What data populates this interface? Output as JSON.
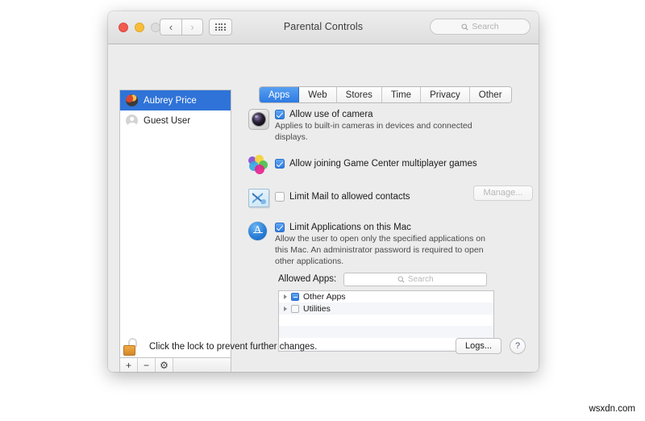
{
  "window": {
    "title": "Parental Controls",
    "traffic_lights": [
      "close",
      "minimize",
      "zoom-disabled"
    ],
    "nav_back": "‹",
    "nav_forward": "›",
    "grid_button": "show-all-icon",
    "toolbar_search_placeholder": "Search"
  },
  "sidebar": {
    "users": [
      {
        "name": "Aubrey Price",
        "selected": true,
        "avatar": "photo-avatar"
      },
      {
        "name": "Guest User",
        "selected": false,
        "avatar": "generic-avatar"
      }
    ],
    "toolbar": {
      "add": "+",
      "remove": "−",
      "settings": "⚙"
    }
  },
  "tabs": [
    {
      "label": "Apps",
      "active": true
    },
    {
      "label": "Web",
      "active": false
    },
    {
      "label": "Stores",
      "active": false
    },
    {
      "label": "Time",
      "active": false
    },
    {
      "label": "Privacy",
      "active": false
    },
    {
      "label": "Other",
      "active": false
    }
  ],
  "options": [
    {
      "id": "camera",
      "icon": "camera-icon",
      "label": "Allow use of camera",
      "description": "Applies to built-in cameras in devices and connected displays.",
      "checked": true
    },
    {
      "id": "game-center",
      "icon": "game-center-icon",
      "label": "Allow joining Game Center multiplayer games",
      "description": "",
      "checked": true
    },
    {
      "id": "mail",
      "icon": "mail-icon",
      "label": "Limit Mail to allowed contacts",
      "description": "",
      "checked": false,
      "button": "Manage...",
      "button_enabled": false
    },
    {
      "id": "limit-apps",
      "icon": "app-store-icon",
      "label": "Limit Applications on this Mac",
      "description": "Allow the user to open only the specified applications on this Mac. An administrator password is required to open other applications.",
      "checked": true
    }
  ],
  "allowed_apps": {
    "label": "Allowed Apps:",
    "search_placeholder": "Search",
    "rows": [
      {
        "name": "Other Apps",
        "state": "mixed",
        "expandable": true
      },
      {
        "name": "Utilities",
        "state": "off",
        "expandable": true
      }
    ]
  },
  "footer": {
    "lock_icon": "unlocked-padlock-icon",
    "lock_text": "Click the lock to prevent further changes.",
    "logs_button": "Logs...",
    "help_button": "?"
  },
  "watermark": "wsxdn.com",
  "colors": {
    "accent": "#2f7be0",
    "selection": "#2f73d8",
    "window_bg": "#ececec",
    "lock": "#e09a3a"
  }
}
